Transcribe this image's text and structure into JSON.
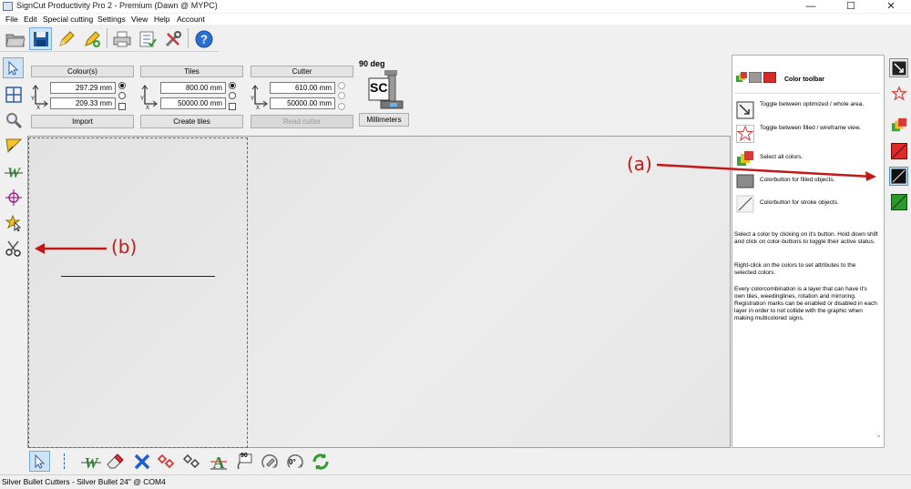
{
  "window": {
    "title": "SignCut Productivity Pro 2 - Premium (Dawn @ MYPC)",
    "minimize": "—",
    "maximize": "☐",
    "close": "✕"
  },
  "menu": [
    "File",
    "Edit",
    "Special cutting",
    "Settings",
    "View",
    "Help",
    "Account"
  ],
  "colours": {
    "header": "Colour(s)",
    "x_value": "297.29 mm",
    "y_value": "209.33 mm",
    "button": "Import"
  },
  "tiles": {
    "header": "Tiles",
    "x_value": "800.00 mm",
    "y_value": "50000.00 mm",
    "button": "Create tiles"
  },
  "cutter": {
    "header": "Cutter",
    "x_value": "610.00 mm",
    "y_value": "50000.00 mm",
    "button": "Read cutter"
  },
  "orientation": {
    "rotation": "90 deg",
    "logo_text": "SC",
    "units_button": "Millimeters"
  },
  "axes": {
    "x": "X",
    "y": "Y"
  },
  "help": {
    "title": "Color toolbar",
    "items": [
      "Toggle between optimized / whole area.",
      "Toggle between filled / wireframe view.",
      "Select all colors.",
      "Colorbutton for filled objects.",
      "Colorbutton for stroke objects."
    ],
    "paragraphs": [
      "Select a color by clicking on it's button. Hold down shift and click on color-buttons to toggle their active status.",
      "Right-click on the colors to set attributes to the selected colors.",
      "Every colorcombination is a layer that can have it's own tiles, weedinglines, rotation and mirroring. Registration marks can be enabled or disabled in each layer in order to not collide with the graphic when making multicolored signs."
    ]
  },
  "bottom_tools": {
    "rotate_90": "90",
    "rotate_0": "0°"
  },
  "status": "Silver Bullet Cutters - Silver Bullet 24\" @ COM4",
  "annotations": {
    "a": "(a)",
    "b": "(b)"
  },
  "colors": {
    "accent_red": "#c21818",
    "page_border": "#5a5acf",
    "canvas": "#e6e6e6"
  }
}
